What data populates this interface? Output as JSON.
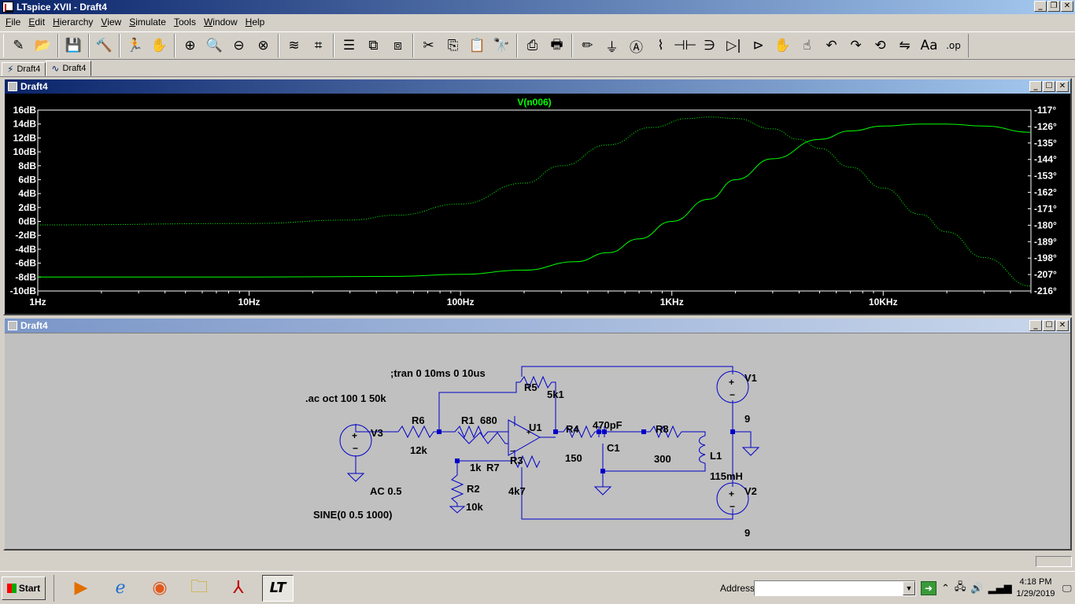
{
  "window": {
    "title": "LTspice XVII - Draft4"
  },
  "menu": [
    {
      "label": "File",
      "key": "F",
      "rest": "ile"
    },
    {
      "label": "Edit",
      "key": "E",
      "rest": "dit"
    },
    {
      "label": "Hierarchy",
      "key": "H",
      "rest": "ierarchy"
    },
    {
      "label": "View",
      "key": "V",
      "rest": "iew"
    },
    {
      "label": "Simulate",
      "key": "S",
      "rest": "imulate"
    },
    {
      "label": "Tools",
      "key": "T",
      "rest": "ools"
    },
    {
      "label": "Window",
      "key": "W",
      "rest": "indow"
    },
    {
      "label": "Help",
      "key": "H",
      "rest": "elp"
    }
  ],
  "toolbar": {
    "groups": [
      [
        {
          "name": "new-schematic",
          "glyph": "✎"
        },
        {
          "name": "open",
          "glyph": "📂"
        }
      ],
      [
        {
          "name": "save",
          "glyph": "💾"
        }
      ],
      [
        {
          "name": "control-panel",
          "glyph": "🔨"
        }
      ],
      [
        {
          "name": "run",
          "glyph": "🏃"
        },
        {
          "name": "halt",
          "glyph": "✋"
        }
      ],
      [
        {
          "name": "zoom-in",
          "glyph": "⊕"
        },
        {
          "name": "zoom-pan",
          "glyph": "🔍"
        },
        {
          "name": "zoom-out",
          "glyph": "⊖"
        },
        {
          "name": "zoom-fit",
          "glyph": "⊗"
        }
      ],
      [
        {
          "name": "autorange",
          "glyph": "≋"
        },
        {
          "name": "pick-visible",
          "glyph": "⌗"
        }
      ],
      [
        {
          "name": "tile-horizontal",
          "glyph": "☰"
        },
        {
          "name": "cascade",
          "glyph": "⧉"
        },
        {
          "name": "tile-vertical",
          "glyph": "⧈"
        }
      ],
      [
        {
          "name": "cut",
          "glyph": "✂"
        },
        {
          "name": "copy",
          "glyph": "⎘"
        },
        {
          "name": "paste",
          "glyph": "📋"
        },
        {
          "name": "find",
          "glyph": "🔭"
        }
      ],
      [
        {
          "name": "print-preview",
          "glyph": "⎙"
        },
        {
          "name": "print",
          "glyph": "🖶"
        }
      ],
      [
        {
          "name": "draw-wire",
          "glyph": "✏"
        },
        {
          "name": "ground",
          "glyph": "⏚"
        },
        {
          "name": "label-net",
          "glyph": "Ⓐ"
        },
        {
          "name": "resistor",
          "glyph": "⌇"
        },
        {
          "name": "capacitor",
          "glyph": "⊣⊢"
        },
        {
          "name": "inductor",
          "glyph": "∋"
        },
        {
          "name": "diode",
          "glyph": "▷|"
        },
        {
          "name": "component",
          "glyph": "⊳"
        },
        {
          "name": "move",
          "glyph": "✋"
        },
        {
          "name": "drag",
          "glyph": "☝"
        },
        {
          "name": "undo",
          "glyph": "↶"
        },
        {
          "name": "redo",
          "glyph": "↷"
        },
        {
          "name": "rotate",
          "glyph": "⟲"
        },
        {
          "name": "mirror",
          "glyph": "⇋"
        },
        {
          "name": "text",
          "glyph": "Aa"
        },
        {
          "name": "spice-directive",
          "glyph": ".op"
        }
      ]
    ]
  },
  "tabs": [
    {
      "label": "Draft4",
      "icon": "schematic-icon",
      "glyph": "⚡"
    },
    {
      "label": "Draft4",
      "icon": "waveform-icon",
      "glyph": "∿"
    }
  ],
  "plot_window": {
    "title": "Draft4"
  },
  "schematic_window": {
    "title": "Draft4"
  },
  "chart_data": {
    "type": "line",
    "title": "V(n006)",
    "x_scale": "log",
    "xlim": [
      1,
      50000
    ],
    "x_ticks": [
      {
        "value": 1,
        "label": "1Hz"
      },
      {
        "value": 10,
        "label": "10Hz"
      },
      {
        "value": 100,
        "label": "100Hz"
      },
      {
        "value": 1000,
        "label": "1KHz"
      },
      {
        "value": 10000,
        "label": "10KHz"
      }
    ],
    "y_left": {
      "ylim": [
        -10,
        16
      ],
      "ticks": [
        "16dB",
        "14dB",
        "12dB",
        "10dB",
        "8dB",
        "6dB",
        "4dB",
        "2dB",
        "0dB",
        "-2dB",
        "-4dB",
        "-6dB",
        "-8dB",
        "-10dB"
      ]
    },
    "y_right": {
      "ylim": [
        -216,
        -117
      ],
      "ticks": [
        "-117°",
        "-126°",
        "-135°",
        "-144°",
        "-153°",
        "-162°",
        "-171°",
        "-180°",
        "-189°",
        "-198°",
        "-207°",
        "-216°"
      ]
    },
    "series": [
      {
        "style": "solid",
        "axis": "left",
        "color": "#00ff00",
        "points": [
          [
            1,
            -8.0
          ],
          [
            10,
            -8.0
          ],
          [
            50,
            -7.9
          ],
          [
            100,
            -7.6
          ],
          [
            200,
            -7.0
          ],
          [
            350,
            -5.8
          ],
          [
            500,
            -4.5
          ],
          [
            700,
            -2.5
          ],
          [
            1000,
            0.0
          ],
          [
            1500,
            3.2
          ],
          [
            2000,
            6.0
          ],
          [
            3000,
            9.0
          ],
          [
            5000,
            11.8
          ],
          [
            7000,
            13.0
          ],
          [
            10000,
            13.7
          ],
          [
            15000,
            14.0
          ],
          [
            20000,
            14.0
          ],
          [
            30000,
            13.7
          ],
          [
            50000,
            12.8
          ]
        ]
      },
      {
        "style": "dotted",
        "axis": "left",
        "color": "#00ff00",
        "points": [
          [
            1,
            -0.5
          ],
          [
            10,
            -0.3
          ],
          [
            30,
            0.2
          ],
          [
            50,
            0.9
          ],
          [
            100,
            2.5
          ],
          [
            200,
            5.5
          ],
          [
            300,
            8.0
          ],
          [
            500,
            11.0
          ],
          [
            800,
            13.5
          ],
          [
            1200,
            14.8
          ],
          [
            1500,
            15.0
          ],
          [
            2000,
            14.8
          ],
          [
            3000,
            13.3
          ],
          [
            4000,
            11.8
          ],
          [
            5000,
            10.5
          ],
          [
            7000,
            7.8
          ],
          [
            10000,
            4.8
          ],
          [
            15000,
            1.0
          ],
          [
            20000,
            -1.5
          ],
          [
            30000,
            -5.2
          ],
          [
            50000,
            -9.3
          ]
        ]
      }
    ]
  },
  "schematic": {
    "directives": [
      {
        "id": "tran",
        "text": ";tran 0 10ms 0 10us"
      },
      {
        "id": "ac",
        "text": ".ac oct 100 1 50k"
      }
    ],
    "labels": [
      {
        "id": "v3-name",
        "text": "V3"
      },
      {
        "id": "v3-value",
        "text": "AC 0.5"
      },
      {
        "id": "v3-sine",
        "text": "SINE(0 0.5 1000)"
      },
      {
        "id": "r6-name",
        "text": "R6"
      },
      {
        "id": "r6-value",
        "text": "12k"
      },
      {
        "id": "r1-name",
        "text": "R1"
      },
      {
        "id": "r1-value",
        "text": "1k"
      },
      {
        "id": "r7-name",
        "text": "R7"
      },
      {
        "id": "r7-value",
        "text": "680"
      },
      {
        "id": "r5-name",
        "text": "R5"
      },
      {
        "id": "r5-value",
        "text": "5k1"
      },
      {
        "id": "u1-name",
        "text": "U1"
      },
      {
        "id": "r3-name",
        "text": "R3"
      },
      {
        "id": "r3-value",
        "text": "4k7"
      },
      {
        "id": "r2-name",
        "text": "R2"
      },
      {
        "id": "r2-value",
        "text": "10k"
      },
      {
        "id": "r4-name",
        "text": "R4"
      },
      {
        "id": "r4-value",
        "text": "150"
      },
      {
        "id": "c1-name",
        "text": "C1"
      },
      {
        "id": "c1-value",
        "text": "470pF"
      },
      {
        "id": "r8-name",
        "text": "R8"
      },
      {
        "id": "r8-value",
        "text": "300"
      },
      {
        "id": "l1-name",
        "text": "L1"
      },
      {
        "id": "l1-value",
        "text": "115mH"
      },
      {
        "id": "v1-name",
        "text": "V1"
      },
      {
        "id": "v1-value",
        "text": "9"
      },
      {
        "id": "v2-name",
        "text": "V2"
      },
      {
        "id": "v2-value",
        "text": "9"
      }
    ]
  },
  "taskbar": {
    "start_label": "Start",
    "apps": [
      {
        "name": "media-player",
        "glyph": "▶"
      },
      {
        "name": "internet-explorer",
        "glyph": "ℯ"
      },
      {
        "name": "firefox",
        "glyph": "◉"
      },
      {
        "name": "file-explorer",
        "glyph": "🗀"
      },
      {
        "name": "acrobat",
        "glyph": "⅄"
      },
      {
        "name": "ltspice",
        "glyph": "LT"
      }
    ],
    "address_label": "Address",
    "address_value": "",
    "time": "4:18 PM",
    "date": "1/29/2019"
  }
}
